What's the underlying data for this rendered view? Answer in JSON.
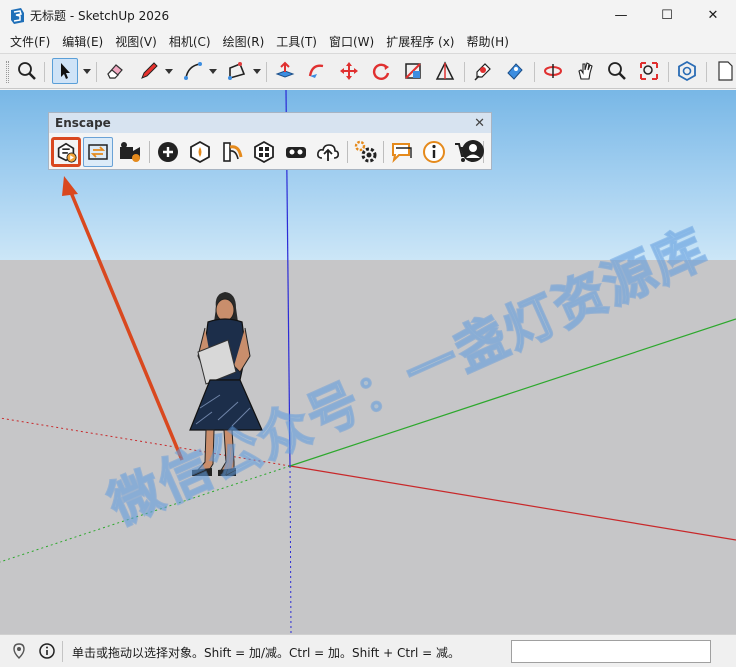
{
  "window": {
    "title": "无标题 - SketchUp 2026",
    "minimize": "—",
    "maximize": "☐",
    "close": "✕"
  },
  "menu": [
    "文件(F)",
    "编辑(E)",
    "视图(V)",
    "相机(C)",
    "绘图(R)",
    "工具(T)",
    "窗口(W)",
    "扩展程序 (x)",
    "帮助(H)"
  ],
  "toolbar_icons": [
    "zoom-extents-icon",
    "select-icon",
    "eraser-icon",
    "pencil-icon",
    "line-icon",
    "rectangle-icon",
    "push-pull-icon",
    "follow-me-icon",
    "move-icon",
    "rotate-icon",
    "section-plane-icon",
    "triangle-icon",
    "paint-icon",
    "tag-icon",
    "walk-icon",
    "pan-icon",
    "zoom-icon",
    "zoom-window-icon",
    "hexagon-icon",
    "new-file-icon"
  ],
  "enscape": {
    "title": "Enscape",
    "close": "✕",
    "buttons": [
      "enscape-start-icon",
      "live-update-icon",
      "video-editor-icon",
      "add-asset-icon",
      "asset-library-icon",
      "material-editor-icon",
      "visual-settings-icon",
      "vr-icon",
      "upload-icon",
      "settings-icon",
      "feedback-icon",
      "info-icon",
      "cart-icon",
      "account-icon"
    ]
  },
  "status": {
    "text": "单击或拖动以选择对象。Shift = 加/减。Ctrl = 加。Shift + Ctrl = 减。",
    "input_value": ""
  },
  "watermark": "微信公众号：一盏灯资源库",
  "colors": {
    "highlight": "#d9481f",
    "axis_red": "#c8282a",
    "axis_green": "#2da82d",
    "axis_blue": "#2b2bd6",
    "sky": "#8cc3ec",
    "ground": "#c6c6c8"
  }
}
